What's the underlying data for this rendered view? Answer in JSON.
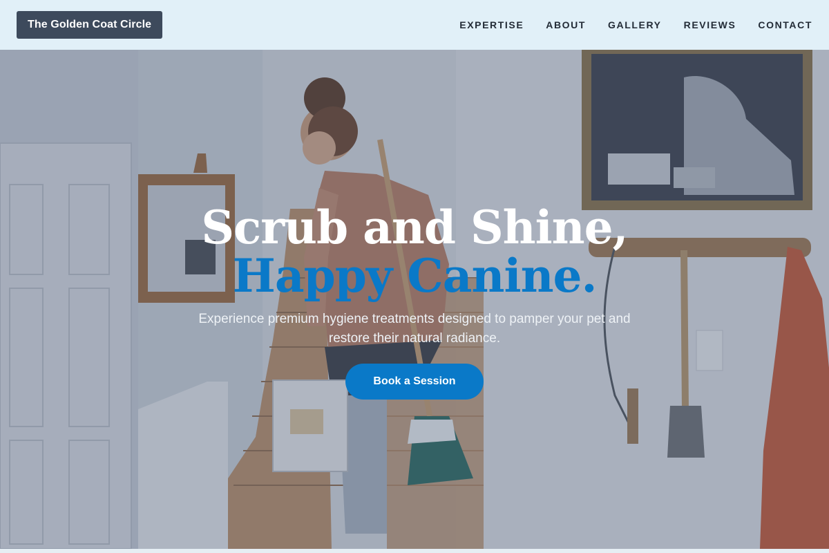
{
  "nav": {
    "brand": "The Golden Coat Circle",
    "links": [
      "EXPERTISE",
      "ABOUT",
      "GALLERY",
      "REVIEWS",
      "CONTACT"
    ]
  },
  "hero": {
    "headline_line1": "Scrub and Shine,",
    "headline_line2": "Happy Canine.",
    "subtext": "Experience premium hygiene treatments designed to pamper your pet and restore their natural radiance.",
    "cta_label": "Book a Session"
  },
  "colors": {
    "accent": "#0a79c8",
    "nav_bg": "#e1f0f8",
    "brand_bg": "#3d4a5c"
  }
}
